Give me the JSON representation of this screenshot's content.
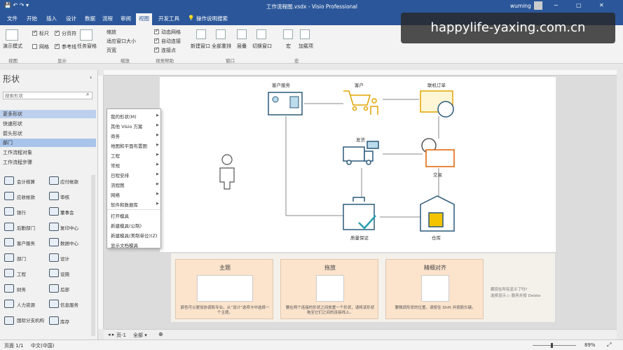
{
  "titlebar": {
    "qat": "💾 ↶ ↷ ▾",
    "doc_title": "工作流程图.vsdx - Visio Professional",
    "user": "wuming",
    "controls": [
      "−",
      "▢",
      "✕"
    ]
  },
  "tabs": [
    "文件",
    "开始",
    "插入",
    "设计",
    "数据",
    "流程",
    "审阅",
    "视图",
    "开发工具",
    "操作说明搜索"
  ],
  "ribbon": {
    "task_pane": "演示模式",
    "checks": [
      {
        "label": "标尺",
        "on": true
      },
      {
        "label": "分页符",
        "on": true
      },
      {
        "label": "网格",
        "on": false
      },
      {
        "label": "参考线",
        "on": true
      }
    ],
    "task_panes": "任务窗格",
    "zoom_items": [
      "缩放",
      "适应窗口大小",
      "页宽"
    ],
    "visual_aids": [
      {
        "label": "动态网格",
        "on": true
      },
      {
        "label": "自动连接",
        "on": true
      },
      {
        "label": "连接点",
        "on": true
      }
    ],
    "window_btns": [
      "新建窗口",
      "全部重排",
      "层叠",
      "切换窗口"
    ],
    "macro_btns": [
      "宏",
      "加载项"
    ],
    "groups": [
      "视图",
      "显示",
      "缩放",
      "视觉帮助",
      "窗口",
      "宏"
    ]
  },
  "left": {
    "title": "形状",
    "search_placeholder": "搜索形状",
    "items": [
      "更多形状",
      "快速形状",
      "箭头形状",
      "部门",
      "工作流程对象",
      "工作流程步骤"
    ],
    "shapes": [
      "会计核算",
      "应付帐款",
      "应收帐款",
      "审核",
      "银行",
      "董事会",
      "后勤部门",
      "复印中心",
      "客户服务",
      "数据中心",
      "部门",
      "设计",
      "工程",
      "设施",
      "财务",
      "后部",
      "人力资源",
      "信息服务",
      "国际分支机构",
      "库存"
    ]
  },
  "menu": {
    "items": [
      "我的形状(M)",
      "其他 Visio 方案",
      "商务",
      "地图和平面布置图",
      "工程",
      "常规",
      "日程安排",
      "流程图",
      "网络",
      "软件和数据库",
      "打开模具",
      "新建模具(公制)",
      "新建模具(美制单位)(Z)",
      "显示文档模具"
    ]
  },
  "diagram": {
    "labels": [
      "客户服务",
      "客户",
      "联机订单",
      "发货",
      "交易",
      "质量保证",
      "仓库"
    ]
  },
  "tips": [
    {
      "title": "主题",
      "desc": "颜色可以更加协调和专业。从“设计”选项卡中选择一个主题。"
    },
    {
      "title": "拖放",
      "desc": "要在两个连接的形状之间放置一个形状，请将该形状拖至它们之间的连接线上。"
    },
    {
      "title": "精细对齐",
      "desc": "要微调形状的位置，请按住 Shift 并按箭头键。"
    }
  ],
  "tip_side": [
    "藏现在所有显示了吗?",
    "选择显示 ▷ 服务并按 Delete"
  ],
  "pagetabs": {
    "page": "页-1",
    "all": "全部 ▾",
    "add": "⊕"
  },
  "status": {
    "page": "页面 1/1",
    "lang": "中文(中国)",
    "zoom": "89%"
  },
  "watermark": "happylife-yaxing.com.cn"
}
